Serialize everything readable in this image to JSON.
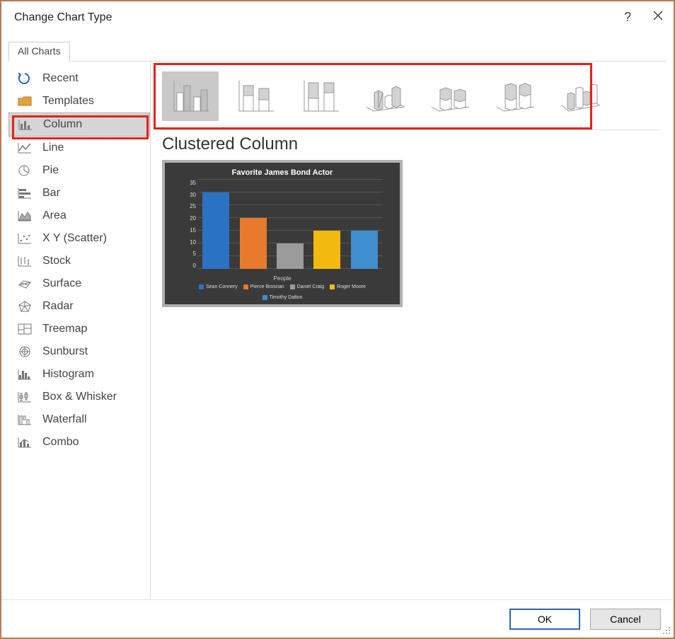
{
  "window": {
    "title": "Change Chart Type"
  },
  "tab": {
    "label": "All Charts"
  },
  "sidebar": {
    "items": [
      {
        "label": "Recent",
        "icon": "recent-icon"
      },
      {
        "label": "Templates",
        "icon": "templates-icon"
      },
      {
        "label": "Column",
        "icon": "column-icon",
        "selected": true
      },
      {
        "label": "Line",
        "icon": "line-icon"
      },
      {
        "label": "Pie",
        "icon": "pie-icon"
      },
      {
        "label": "Bar",
        "icon": "bar-icon"
      },
      {
        "label": "Area",
        "icon": "area-icon"
      },
      {
        "label": "X Y (Scatter)",
        "icon": "scatter-icon"
      },
      {
        "label": "Stock",
        "icon": "stock-icon"
      },
      {
        "label": "Surface",
        "icon": "surface-icon"
      },
      {
        "label": "Radar",
        "icon": "radar-icon"
      },
      {
        "label": "Treemap",
        "icon": "treemap-icon"
      },
      {
        "label": "Sunburst",
        "icon": "sunburst-icon"
      },
      {
        "label": "Histogram",
        "icon": "histogram-icon"
      },
      {
        "label": "Box & Whisker",
        "icon": "boxwhisker-icon"
      },
      {
        "label": "Waterfall",
        "icon": "waterfall-icon"
      },
      {
        "label": "Combo",
        "icon": "combo-icon"
      }
    ]
  },
  "subtypes": {
    "selected_index": 0,
    "items": [
      "clustered-column",
      "stacked-column",
      "100-stacked-column",
      "3d-clustered-column",
      "3d-stacked-column",
      "3d-100-stacked-column",
      "3d-column"
    ]
  },
  "subtype_title": "Clustered Column",
  "chart_data": {
    "type": "bar",
    "title": "Favorite James Bond Actor",
    "xlabel": "People",
    "ylabel": "",
    "ylim": [
      0,
      35
    ],
    "yticks": [
      0,
      5,
      10,
      15,
      20,
      25,
      30,
      35
    ],
    "categories": [
      "Sean Connery",
      "Pierce Brosnan",
      "Daniel Craig",
      "Roger Moore",
      "Timothy Dalton"
    ],
    "values": [
      30,
      20,
      10,
      15,
      15
    ],
    "colors": [
      "#2a72c4",
      "#e87a2d",
      "#9b9b9b",
      "#f2b90f",
      "#3e8ed0"
    ]
  },
  "buttons": {
    "ok": "OK",
    "cancel": "Cancel"
  }
}
